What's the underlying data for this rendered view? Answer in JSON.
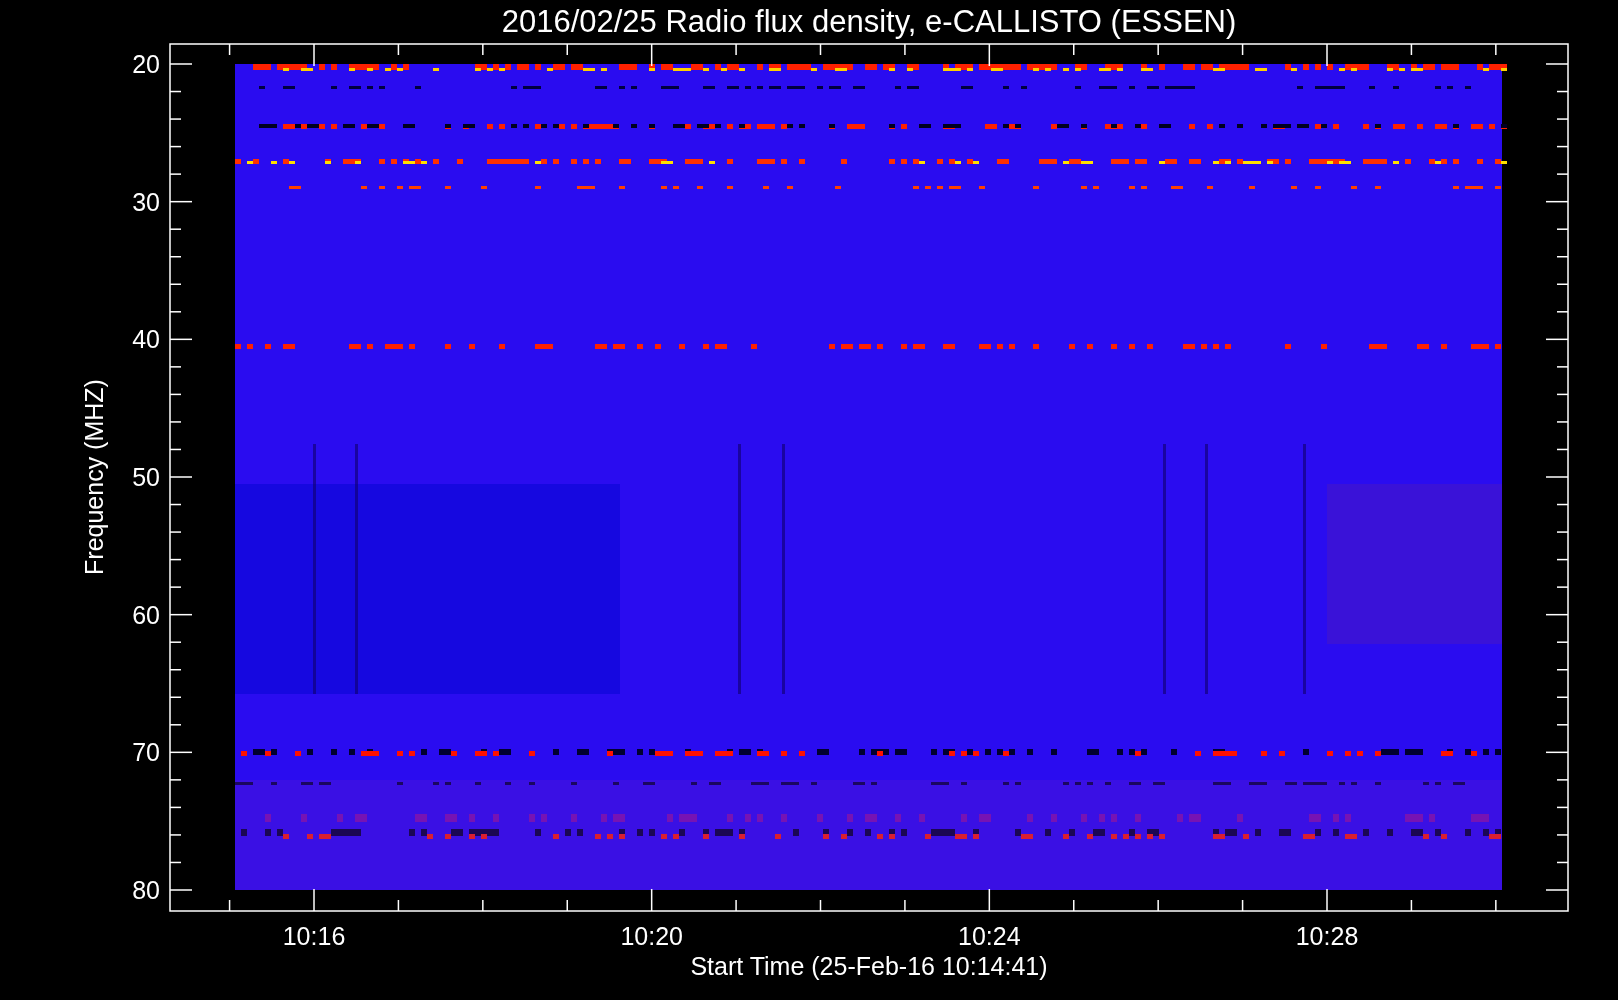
{
  "title": "2016/02/25  Radio flux density, e-CALLISTO (ESSEN)",
  "ylabel": "Frequency (MHZ)",
  "xlabel": "Start Time (25-Feb-16 10:14:41)",
  "yticks": [
    "20",
    "30",
    "40",
    "50",
    "60",
    "70",
    "80"
  ],
  "xticks": [
    "10:16",
    "10:20",
    "10:24",
    "10:28"
  ]
}
